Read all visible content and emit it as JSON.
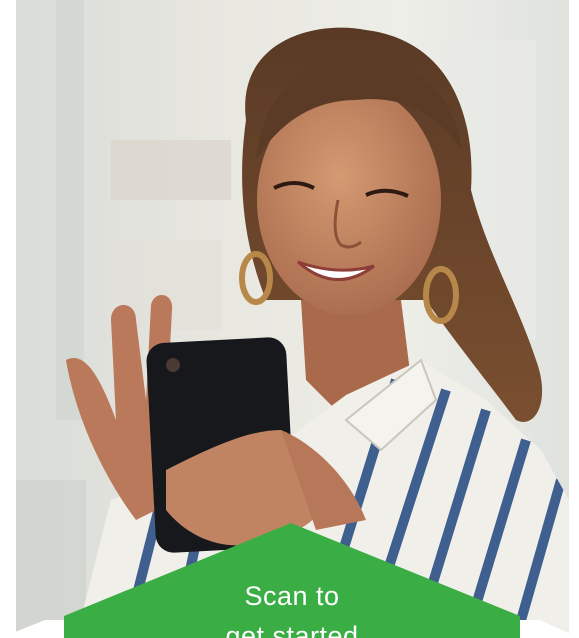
{
  "promo": {
    "cta_line1": "Scan to",
    "cta_line2": "get started",
    "accent_color": "#3aad45",
    "photo_subject": "smiling woman using a smartphone"
  }
}
